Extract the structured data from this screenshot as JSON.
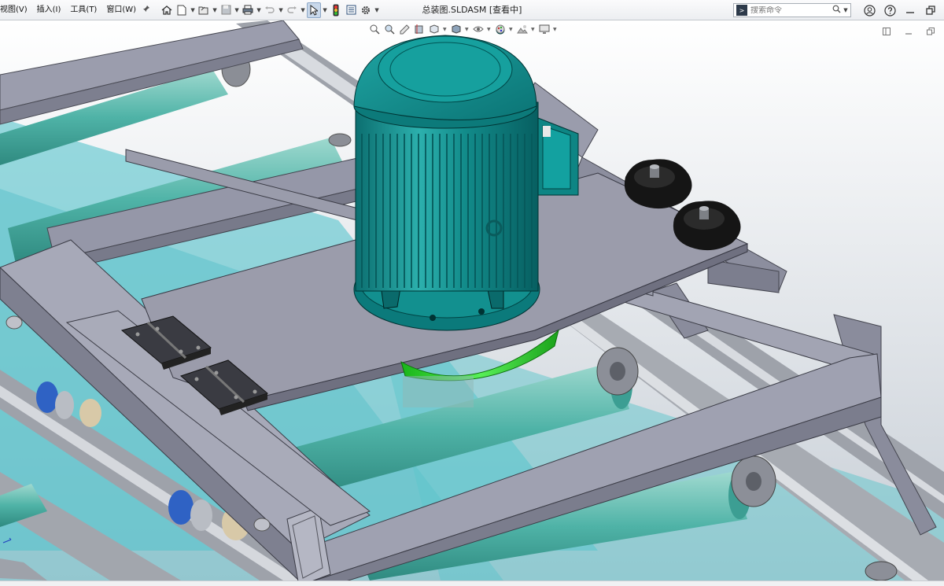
{
  "menu": {
    "items": [
      "视图(V)",
      "插入(I)",
      "工具(T)",
      "窗口(W)"
    ]
  },
  "document": {
    "title": "总装图.SLDASM [查看中]"
  },
  "search": {
    "placeholder": "搜索命令"
  },
  "icons": {
    "toolbar": [
      "home-icon",
      "new-document-icon",
      "open-icon",
      "save-icon",
      "print-icon",
      "undo-icon",
      "redo-icon",
      "select-icon",
      "traffic-light-icon",
      "file-properties-icon",
      "options-gear-icon"
    ],
    "right": [
      "search-icon",
      "user-icon",
      "help-icon",
      "minimize-icon",
      "restore-icon"
    ],
    "view": [
      "zoom-fit-icon",
      "zoom-area-icon",
      "previous-view-icon",
      "section-view-icon",
      "view-orientation-icon",
      "display-style-icon",
      "hide-show-icon",
      "edit-appearance-icon",
      "apply-scene-icon",
      "view-settings-icon"
    ]
  },
  "colors": {
    "motor": "#0f8a8a",
    "frame": "#8e90a2",
    "roller": "#4fb3a7",
    "coupling": "#33d433",
    "background_top": "#ffffff",
    "background_bottom": "#c9d0d8"
  }
}
